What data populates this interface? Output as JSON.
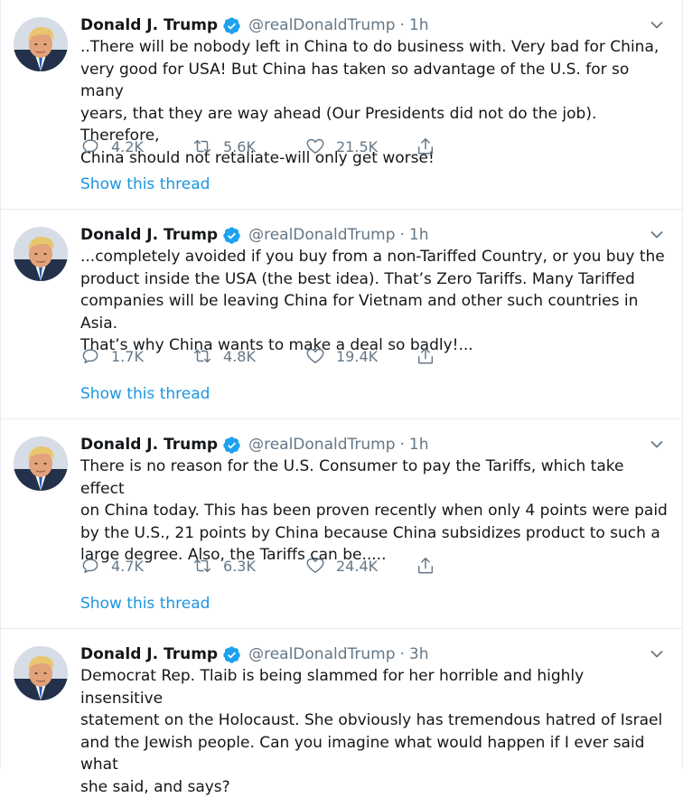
{
  "tweets": [
    {
      "name": "Donald J. Trump",
      "handle": "@realDonaldTrump",
      "dot": "·",
      "time": "1h",
      "text": "..There will be nobody left in China to do business with. Very bad for China,\nvery good for USA! But China has taken so advantage of the U.S. for so many\nyears, that they are way ahead (Our Presidents did not do the job). Therefore,\nChina should not retaliate-will only get worse!",
      "replies": "4.2K",
      "retweets": "5.6K",
      "likes": "21.5K",
      "show_thread": "Show this thread"
    },
    {
      "name": "Donald J. Trump",
      "handle": "@realDonaldTrump",
      "dot": "·",
      "time": "1h",
      "text": "...completely avoided if you buy from a non-Tariffed Country, or you buy the\nproduct inside the USA (the best idea). That’s Zero Tariffs. Many Tariffed\ncompanies will be leaving China for Vietnam and other such countries in Asia.\nThat’s why China wants to make a deal so badly!...",
      "replies": "1.7K",
      "retweets": "4.8K",
      "likes": "19.4K",
      "show_thread": "Show this thread"
    },
    {
      "name": "Donald J. Trump",
      "handle": "@realDonaldTrump",
      "dot": "·",
      "time": "1h",
      "text": "There is no reason for the U.S. Consumer to pay the Tariffs, which take effect\non China today. This has been proven recently when only 4 points were paid\nby the U.S., 21 points by China because China subsidizes product to such a\nlarge degree. Also, the Tariffs can be.....",
      "replies": "4.7K",
      "retweets": "6.3K",
      "likes": "24.4K",
      "show_thread": "Show this thread"
    },
    {
      "name": "Donald J. Trump",
      "handle": "@realDonaldTrump",
      "dot": "·",
      "time": "3h",
      "text": "Democrat Rep. Tlaib is being slammed for her horrible and highly insensitive\nstatement on the Holocaust. She obviously has tremendous hatred of Israel\nand the Jewish people. Can you imagine what would happen if I ever said what\nshe said, and says?"
    }
  ],
  "icons": {
    "verified": "verified-badge-icon",
    "caret": "chevron-down-icon",
    "reply": "reply-icon",
    "retweet": "retweet-icon",
    "like": "heart-icon",
    "share": "share-icon"
  },
  "colors": {
    "accent": "#1b95e0",
    "verified": "#1da1f2",
    "secondary_text": "#657786",
    "divider": "#e6ecf0"
  }
}
